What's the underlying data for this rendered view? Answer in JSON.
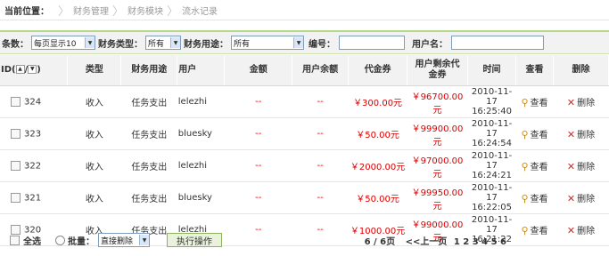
{
  "breadcrumb": {
    "label": "当前位置：",
    "items": [
      "财务管理",
      "财务模块",
      "流水记录"
    ]
  },
  "filter": {
    "conditions_label": "条数：",
    "page_size": "每页显示10",
    "type_label": "财务类型：",
    "type_value": "所有",
    "purpose_label": "财务用途：",
    "purpose_value": "所有",
    "number_label": "编号：",
    "username_label": "用户名："
  },
  "table": {
    "headers": {
      "id": "ID(",
      "id_sep": "/",
      "id_end": ")",
      "type": "类型",
      "purpose": "财务用途",
      "user": "用户",
      "amount": "金额",
      "balance": "用户余额",
      "voucher": "代金券",
      "voucher_balance_1": "用户剩余代",
      "voucher_balance_2": "金券",
      "time": "时间",
      "view": "查看",
      "delete": "删除"
    },
    "rows": [
      {
        "id": "324",
        "type": "收入",
        "purpose": "任务支出",
        "user": "lelezhi",
        "amount": "--",
        "balance": "--",
        "voucher": "￥300.00元",
        "remain": "￥96700.00元",
        "date": "2010-11-17",
        "time": "16:25:40",
        "view": "查看",
        "del": "删除"
      },
      {
        "id": "323",
        "type": "收入",
        "purpose": "任务支出",
        "user": "bluesky",
        "amount": "--",
        "balance": "--",
        "voucher": "￥50.00元",
        "remain": "￥99900.00元",
        "date": "2010-11-17",
        "time": "16:24:54",
        "view": "查看",
        "del": "删除"
      },
      {
        "id": "322",
        "type": "收入",
        "purpose": "任务支出",
        "user": "lelezhi",
        "amount": "--",
        "balance": "--",
        "voucher": "￥2000.00元",
        "remain": "￥97000.00元",
        "date": "2010-11-17",
        "time": "16:24:21",
        "view": "查看",
        "del": "删除"
      },
      {
        "id": "321",
        "type": "收入",
        "purpose": "任务支出",
        "user": "bluesky",
        "amount": "--",
        "balance": "--",
        "voucher": "￥50.00元",
        "remain": "￥99950.00元",
        "date": "2010-11-17",
        "time": "16:22:05",
        "view": "查看",
        "del": "删除"
      },
      {
        "id": "320",
        "type": "收入",
        "purpose": "任务支出",
        "user": "lelezhi",
        "amount": "--",
        "balance": "--",
        "voucher": "￥1000.00元",
        "remain": "￥99000.00元",
        "date": "2010-11-17",
        "time": "16:21:22",
        "view": "查看",
        "del": "删除"
      }
    ]
  },
  "footer": {
    "select_all": "全选",
    "batch": "批量：",
    "action_value": "直接删除",
    "execute": "执行操作",
    "page_info": "6 / 6页",
    "prev": "<<上一页",
    "pages": "1 2 3 4 5 6"
  },
  "icons": {
    "view": "magnifier-icon",
    "delete": "red-x-icon"
  },
  "colors": {
    "accent_green": "#b6d987",
    "money_red": "#dd0000"
  }
}
